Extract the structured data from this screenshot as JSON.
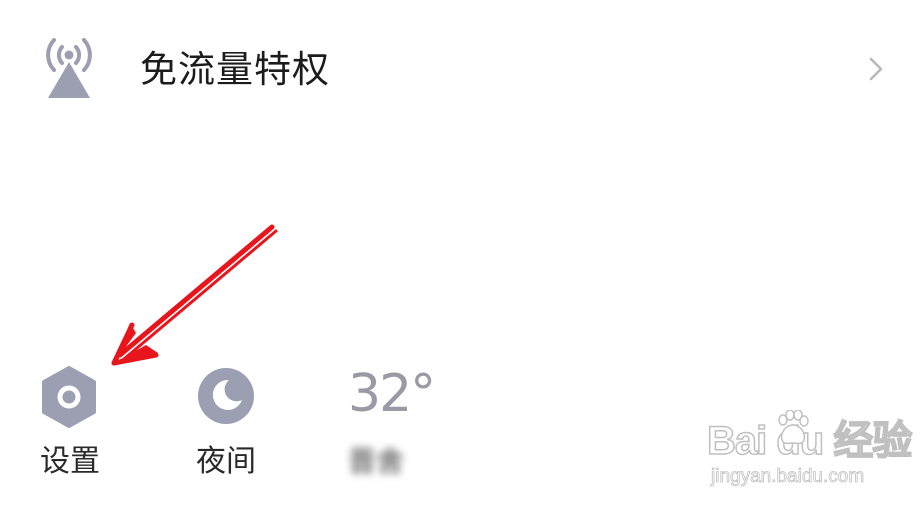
{
  "menu": {
    "traffic_free": {
      "icon": "signal-tower-icon",
      "label": "免流量特权",
      "chevron": "chevron-right-icon"
    }
  },
  "toolbar": {
    "settings": {
      "icon": "gear-icon",
      "label": "设置"
    },
    "night": {
      "icon": "moon-icon",
      "label": "夜间"
    },
    "weather": {
      "temperature": "32°",
      "description": "晋舍"
    }
  },
  "annotation": {
    "arrow_color": "#e8161c",
    "points_to": "settings"
  },
  "watermark": {
    "brand": "Bai du 经验",
    "url": "jingyan.baidu.com"
  },
  "colors": {
    "icon_gray": "#9c9fb2",
    "text_dark": "#1c1c1c",
    "chevron": "#b8b8b8",
    "arrow_red": "#e8161c"
  }
}
